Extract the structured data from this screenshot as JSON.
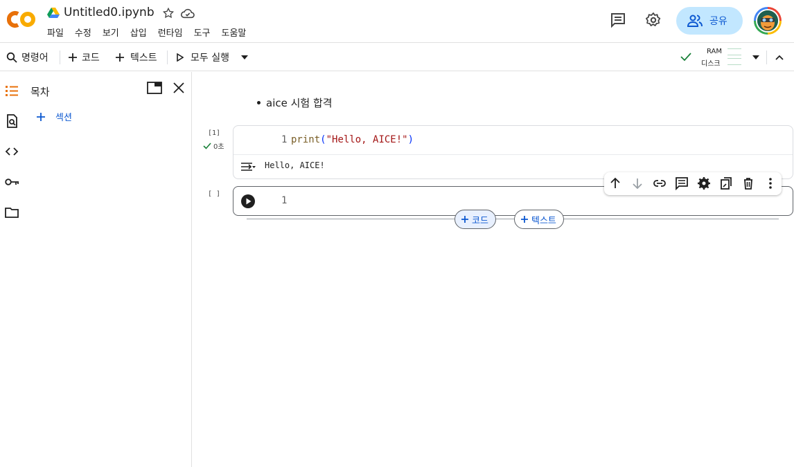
{
  "header": {
    "notebook_title": "Untitled0.ipynb",
    "menu": [
      "파일",
      "수정",
      "보기",
      "삽입",
      "런타임",
      "도구",
      "도움말"
    ],
    "share_label": "공유",
    "icons": [
      "colab-logo-icon",
      "drive-icon",
      "star-icon",
      "cloud-sync-icon",
      "comment-icon",
      "gear-icon",
      "people-icon",
      "avatar"
    ]
  },
  "toolbar": {
    "command_label": "명령어",
    "add_code_label": "코드",
    "add_text_label": "텍스트",
    "run_all_label": "모두 실행",
    "ram_label": "RAM",
    "disk_label": "디스크"
  },
  "sidebar": {
    "panel_title": "목차",
    "add_section_label": "섹션",
    "rail_icons": [
      "toc-icon",
      "find-icon",
      "code-snippets-icon",
      "key-icon",
      "folder-icon"
    ]
  },
  "notebook": {
    "text_cell_bullet": "aice 시험 합격",
    "cells": [
      {
        "exec_count": "[1]",
        "exec_time": "0초",
        "line_number": "1",
        "code_fn": "print",
        "code_open": "(",
        "code_str": "\"Hello, AICE!\"",
        "code_close": ")",
        "output": "Hello, AICE!"
      },
      {
        "exec_count": "[ ]",
        "line_number": "1"
      }
    ],
    "add_code_label": "코드",
    "add_text_label": "텍스트"
  },
  "colors": {
    "accent": "#0b57d0",
    "share_bg": "#c2e7ff",
    "logo_orange": "#f9ab00",
    "logo_dark_orange": "#e8710a",
    "check_green": "#188038"
  }
}
